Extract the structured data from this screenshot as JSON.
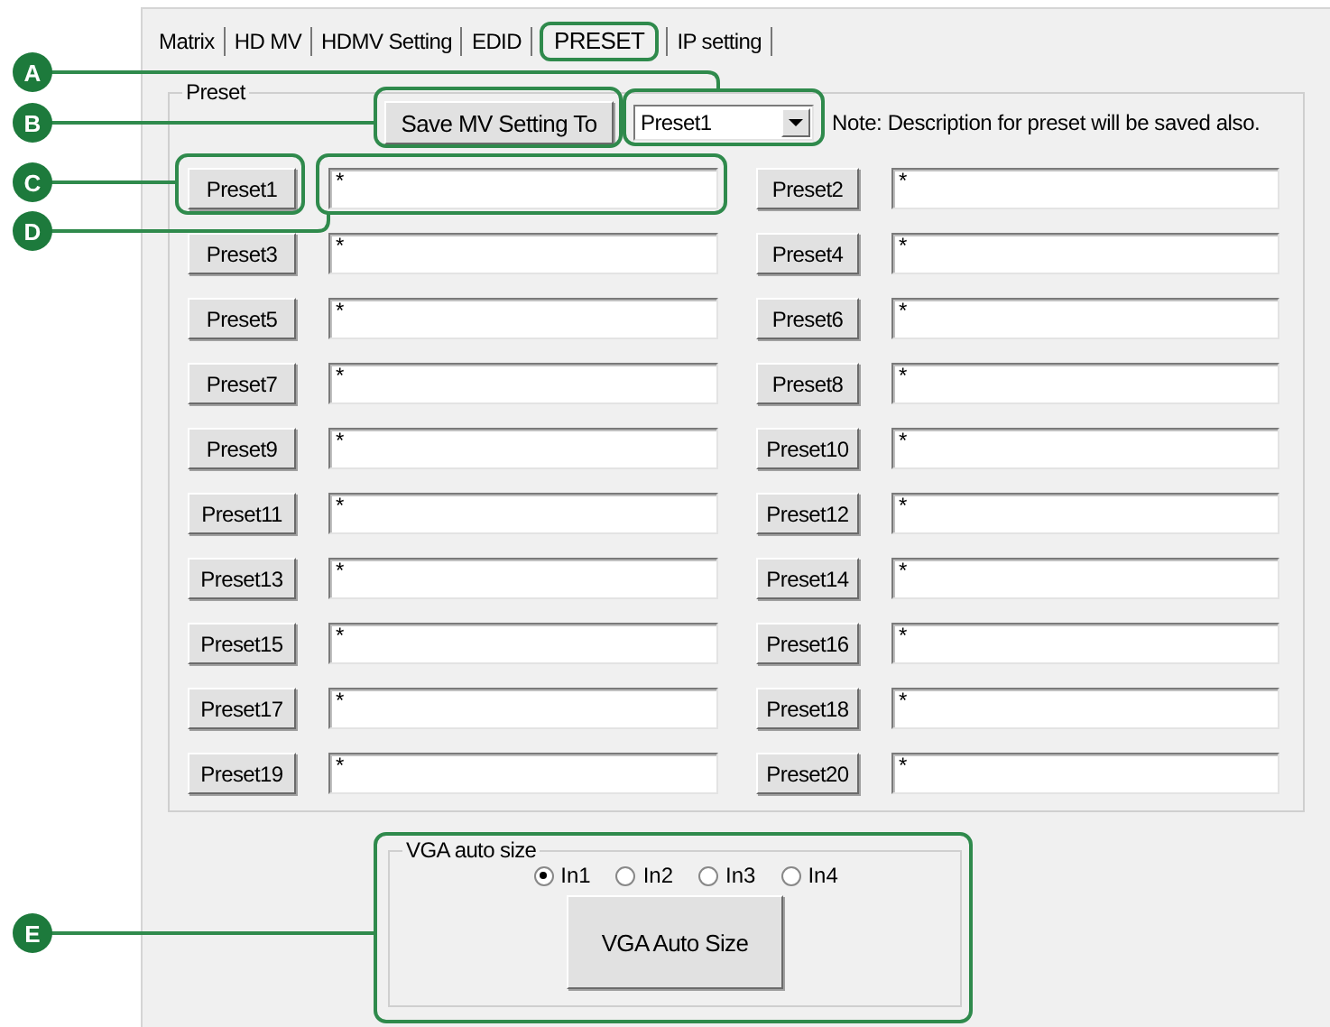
{
  "tabs": [
    {
      "label": "Matrix",
      "selected": false
    },
    {
      "label": "HD MV",
      "selected": false
    },
    {
      "label": "HDMV Setting",
      "selected": false
    },
    {
      "label": "EDID",
      "selected": false
    },
    {
      "label": "PRESET",
      "selected": true
    },
    {
      "label": "IP setting",
      "selected": false
    }
  ],
  "preset_group": {
    "title": "Preset",
    "save_button": "Save MV Setting To",
    "dropdown": {
      "value": "Preset1"
    },
    "note": "Note: Description for preset will be saved also.",
    "presets": [
      {
        "button": "Preset1",
        "value": "*"
      },
      {
        "button": "Preset2",
        "value": "*"
      },
      {
        "button": "Preset3",
        "value": "*"
      },
      {
        "button": "Preset4",
        "value": "*"
      },
      {
        "button": "Preset5",
        "value": "*"
      },
      {
        "button": "Preset6",
        "value": "*"
      },
      {
        "button": "Preset7",
        "value": "*"
      },
      {
        "button": "Preset8",
        "value": "*"
      },
      {
        "button": "Preset9",
        "value": "*"
      },
      {
        "button": "Preset10",
        "value": "*"
      },
      {
        "button": "Preset11",
        "value": "*"
      },
      {
        "button": "Preset12",
        "value": "*"
      },
      {
        "button": "Preset13",
        "value": "*"
      },
      {
        "button": "Preset14",
        "value": "*"
      },
      {
        "button": "Preset15",
        "value": "*"
      },
      {
        "button": "Preset16",
        "value": "*"
      },
      {
        "button": "Preset17",
        "value": "*"
      },
      {
        "button": "Preset18",
        "value": "*"
      },
      {
        "button": "Preset19",
        "value": "*"
      },
      {
        "button": "Preset20",
        "value": "*"
      }
    ]
  },
  "vga_group": {
    "title": "VGA auto size",
    "inputs": [
      {
        "label": "In1",
        "selected": true
      },
      {
        "label": "In2",
        "selected": false
      },
      {
        "label": "In3",
        "selected": false
      },
      {
        "label": "In4",
        "selected": false
      }
    ],
    "button": "VGA Auto Size"
  },
  "callouts": [
    {
      "label": "A"
    },
    {
      "label": "B"
    },
    {
      "label": "C"
    },
    {
      "label": "D"
    },
    {
      "label": "E"
    }
  ]
}
